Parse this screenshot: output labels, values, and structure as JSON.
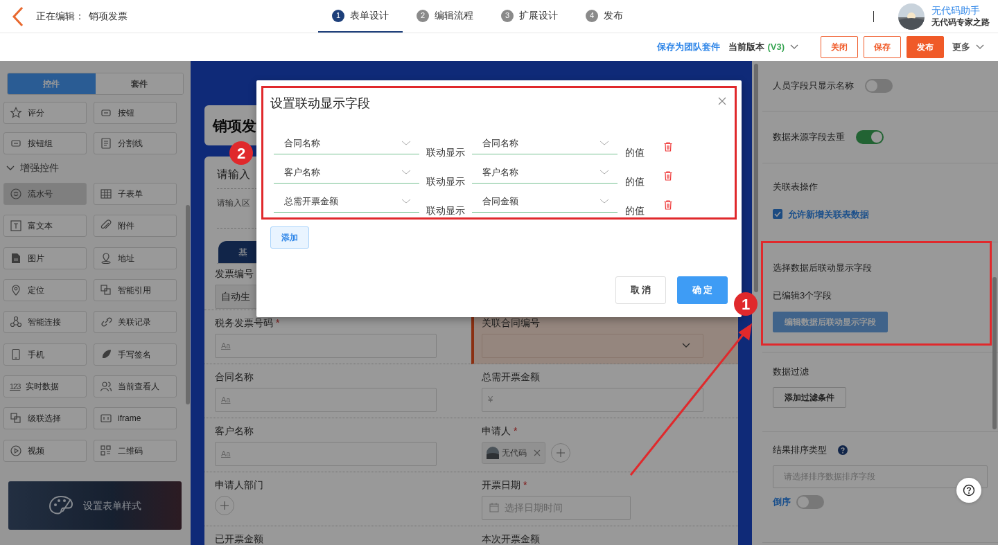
{
  "header": {
    "editing_label": "正在编辑：",
    "form_name": "销项发票",
    "steps": [
      {
        "number": "1",
        "label": "表单设计",
        "selected": true
      },
      {
        "number": "2",
        "label": "编辑流程",
        "selected": false
      },
      {
        "number": "3",
        "label": "扩展设计",
        "selected": false
      },
      {
        "number": "4",
        "label": "发布",
        "selected": false
      }
    ],
    "user": {
      "name": "无代码助手",
      "subtitle": "无代码专家之路"
    }
  },
  "toolbar": {
    "save_as_kit": "保存为团队套件",
    "version_label": "当前版本",
    "version": "(V3)",
    "buttons": [
      {
        "label": "关闭",
        "kind": "outline"
      },
      {
        "label": "保存",
        "kind": "outline"
      },
      {
        "label": "发布",
        "kind": "primary"
      }
    ],
    "more": "更多"
  },
  "palette": {
    "tabs": [
      {
        "label": "控件",
        "selected": true
      },
      {
        "label": "套件",
        "selected": false
      }
    ],
    "basic_items": [
      {
        "label": "评分",
        "selected": false
      },
      {
        "label": "按钮",
        "selected": false
      },
      {
        "label": "按钮组",
        "selected": false
      },
      {
        "label": "分割线",
        "selected": false
      }
    ],
    "section": {
      "title": "增强控件",
      "expanded": true
    },
    "items": [
      {
        "label": "流水号",
        "selected": true
      },
      {
        "label": "子表单",
        "selected": false
      },
      {
        "label": "富文本",
        "selected": false
      },
      {
        "label": "附件",
        "selected": false
      },
      {
        "label": "图片",
        "selected": false
      },
      {
        "label": "地址",
        "selected": false
      },
      {
        "label": "定位",
        "selected": false
      },
      {
        "label": "智能引用",
        "selected": false
      },
      {
        "label": "智能连接",
        "selected": false
      },
      {
        "label": "关联记录",
        "selected": false
      },
      {
        "label": "手机",
        "selected": false
      },
      {
        "label": "手写签名",
        "selected": false
      },
      {
        "label": "实时数据",
        "icon_text": "123",
        "selected": false
      },
      {
        "label": "当前查看人",
        "selected": false
      },
      {
        "label": "级联选择",
        "selected": false
      },
      {
        "label": "iframe",
        "selected": false
      },
      {
        "label": "视频",
        "selected": false
      },
      {
        "label": "二维码",
        "selected": false
      }
    ],
    "style_button": "设置表单样式"
  },
  "form": {
    "title": "销项发",
    "section_title": "请输入",
    "section_description": "请输入区",
    "tab": "基",
    "fields": [
      {
        "label": "发票编号",
        "kind": "readonly",
        "value": "自动生"
      },
      {
        "label": "税务发票号码",
        "kind": "text",
        "placeholder": "Aa",
        "required_mark": "*"
      },
      {
        "label": "关联合同编号",
        "kind": "select",
        "highlighted": true
      },
      {
        "label": "合同名称",
        "kind": "text",
        "placeholder": "Aa"
      },
      {
        "label": "总需开票金额",
        "kind": "currency",
        "placeholder": "¥"
      },
      {
        "label": "客户名称",
        "kind": "text",
        "placeholder": "Aa"
      },
      {
        "label": "申请人",
        "kind": "person",
        "value": "无代码",
        "required_mark": "*"
      },
      {
        "label": "申请人部门",
        "kind": "add"
      },
      {
        "label": "开票日期",
        "kind": "date",
        "placeholder": "选择日期时间",
        "required_mark": "*"
      },
      {
        "label": "已开票金额",
        "kind": "label"
      },
      {
        "label": "本次开票金额",
        "kind": "label"
      }
    ]
  },
  "settings": {
    "sections": [
      {
        "kind": "toggle",
        "label": "人员字段只显示名称",
        "on": false
      },
      {
        "kind": "toggle",
        "label": "数据来源字段去重",
        "on": true
      },
      {
        "kind": "checkbox",
        "title": "关联表操作",
        "label": "允许新增关联表数据",
        "checked": true
      },
      {
        "kind": "button",
        "title": "选择数据后联动显示字段",
        "status": "已编辑3个字段",
        "button": "编辑数据后联动显示字段",
        "primary": true
      },
      {
        "kind": "button",
        "title": "数据过滤",
        "button": "添加过滤条件",
        "primary": false
      },
      {
        "kind": "sort",
        "title": "结果排序类型",
        "placeholder": "请选择排序数据排序字段",
        "toggle_label": "倒序",
        "on": false
      }
    ]
  },
  "dialog": {
    "title": "设置联动显示字段",
    "rows": [
      {
        "source": "合同名称",
        "connector": "联动显示",
        "target": "合同名称",
        "suffix": "的值"
      },
      {
        "source": "客户名称",
        "connector": "联动显示",
        "target": "客户名称",
        "suffix": "的值"
      },
      {
        "source": "总需开票金额",
        "connector": "联动显示",
        "target": "合同金额",
        "suffix": "的值"
      }
    ],
    "add_button": "添加",
    "cancel": "取 消",
    "confirm": "确 定"
  },
  "annotations": {
    "markers": [
      {
        "label": "1"
      },
      {
        "label": "2"
      }
    ]
  }
}
